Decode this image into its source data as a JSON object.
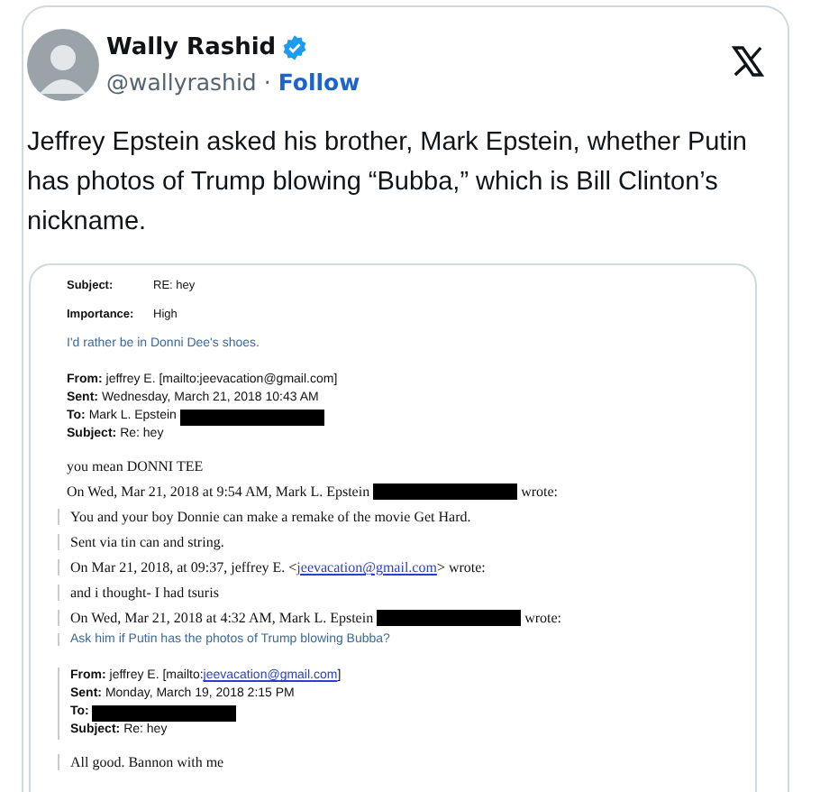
{
  "tweet": {
    "author": "Wally Rashid",
    "verified": true,
    "handle": "@wallyrashid",
    "separator": "·",
    "follow": "Follow",
    "text": "Jeffrey Epstein asked his brother, Mark Epstein, whether Putin has photos of Trump blowing “Bubba,” which is Bill Clinton’s nickname."
  },
  "email": {
    "lines": [
      {
        "kind": "field",
        "label": "Subject:",
        "text": "RE: hey"
      },
      {
        "kind": "field",
        "label": "Importance:",
        "text": "High"
      },
      {
        "kind": "blue",
        "text": "I'd rather be in Donni Dee's shoes."
      },
      {
        "kind": "header",
        "text": "**From:** jeffrey E. [mailto:jeevacation@gmail.com]"
      },
      {
        "kind": "header",
        "text": "**Sent:** Wednesday, March 21, 2018 10:43 AM"
      },
      {
        "kind": "header",
        "text": "**To:** Mark L. Epstein",
        "redacted": true
      },
      {
        "kind": "header",
        "text": "**Subject:** Re: hey"
      },
      {
        "kind": "body",
        "text": "you mean DONNI TEE"
      },
      {
        "kind": "body",
        "text": "On Wed, Mar 21, 2018 at 9:54 AM, Mark L. Epstein",
        "redacted": true,
        "after": "wrote:"
      },
      {
        "kind": "body",
        "quoted": true,
        "text": "You and your boy Donnie can make a remake of the movie Get Hard."
      },
      {
        "kind": "body",
        "quoted": true,
        "text": "Sent via tin can and string."
      },
      {
        "kind": "body",
        "quoted": true,
        "text": "On Mar 21, 2018, at 09:37, jeffrey E. <",
        "link": "jeevacation@gmail.com",
        "tail": "> wrote:"
      },
      {
        "kind": "body",
        "quoted": true,
        "text": "and i thought- I had tsuris"
      },
      {
        "kind": "body",
        "quoted": true,
        "text": "On Wed, Mar 21, 2018 at 4:32 AM, Mark L. Epstein",
        "redacted": true,
        "after": "wrote:"
      },
      {
        "kind": "blue",
        "quoted": true,
        "text": "Ask him if Putin has the photos of Trump blowing Bubba?"
      },
      {
        "kind": "header",
        "quoted": true,
        "text": "**From:** jeffrey E. [mailto:",
        "link": "jeevacation@gmail.com",
        "tail": "]"
      },
      {
        "kind": "header",
        "quoted": true,
        "text": "**Sent:** Monday, March 19, 2018 2:15 PM"
      },
      {
        "kind": "header",
        "quoted": true,
        "text": "**To:**",
        "redacted": true
      },
      {
        "kind": "header",
        "quoted": true,
        "text": "**Subject:** Re: hey"
      },
      {
        "kind": "body",
        "quoted": true,
        "text": "All good. Bannon with me"
      }
    ]
  }
}
